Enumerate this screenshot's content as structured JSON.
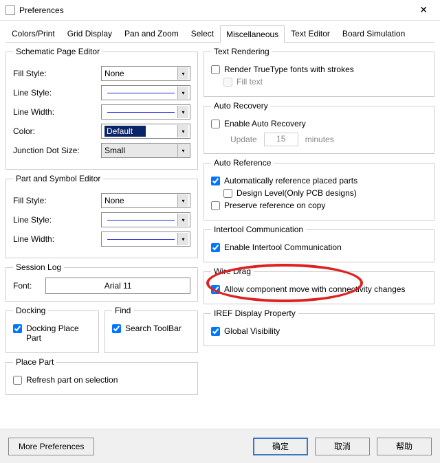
{
  "window": {
    "title": "Preferences"
  },
  "tabs": [
    "Colors/Print",
    "Grid Display",
    "Pan and Zoom",
    "Select",
    "Miscellaneous",
    "Text Editor",
    "Board Simulation"
  ],
  "activeTab": "Miscellaneous",
  "schematicPageEditor": {
    "legend": "Schematic Page Editor",
    "fillStyleLabel": "Fill Style:",
    "fillStyle": "None",
    "lineStyleLabel": "Line Style:",
    "lineWidthLabel": "Line Width:",
    "colorLabel": "Color:",
    "color": "Default",
    "junctionLabel": "Junction Dot Size:",
    "junction": "Small"
  },
  "partSymbolEditor": {
    "legend": "Part and Symbol Editor",
    "fillStyleLabel": "Fill Style:",
    "fillStyle": "None",
    "lineStyleLabel": "Line Style:",
    "lineWidthLabel": "Line Width:"
  },
  "sessionLog": {
    "legend": "Session Log",
    "fontLabel": "Font:",
    "fontValue": "Arial 11"
  },
  "docking": {
    "legend": "Docking",
    "dockingPlacePart": "Docking Place Part"
  },
  "find": {
    "legend": "Find",
    "searchToolbar": "Search ToolBar"
  },
  "placePart": {
    "legend": "Place Part",
    "refreshLabel": "Refresh part on selection"
  },
  "textRendering": {
    "legend": "Text Rendering",
    "renderTrueType": "Render TrueType fonts with strokes",
    "fillText": "Fill text"
  },
  "autoRecovery": {
    "legend": "Auto Recovery",
    "enableLabel": "Enable Auto Recovery",
    "updateLabel": "Update",
    "updateValue": "15",
    "minutesLabel": "minutes"
  },
  "autoReference": {
    "legend": "Auto Reference",
    "autoRef": "Automatically reference placed parts",
    "designLevel": "Design Level(Only PCB designs)",
    "preserve": "Preserve reference on copy"
  },
  "intertool": {
    "legend": "Intertool Communication",
    "enable": "Enable Intertool Communication"
  },
  "wireDrag": {
    "legend": "Wire Drag",
    "allowMove": "Allow component move with connectivity changes"
  },
  "iref": {
    "legend": "IREF Display Property",
    "global": "Global Visibility"
  },
  "footer": {
    "more": "More Preferences",
    "ok": "确定",
    "cancel": "取消",
    "help": "帮助"
  }
}
